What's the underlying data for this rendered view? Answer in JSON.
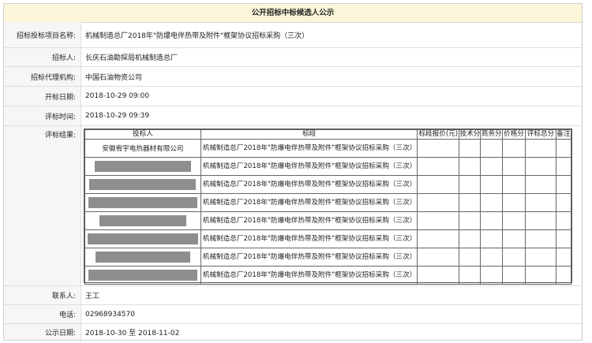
{
  "title": "公开招标中标候选人公示",
  "fields": {
    "project_label": "招标投标项目名称:",
    "project_value": "机械制造总厂2018年\"防爆电伴热带及附件\"框架协议招标采购（三次）",
    "tenderer_label": "招标人:",
    "tenderer_value": "长庆石油勘探局机械制造总厂",
    "agency_label": "招标代理机构:",
    "agency_value": "中国石油物资公司",
    "open_label": "开标日期:",
    "open_value": "2018-10-29 09:00",
    "eval_label": "评标时间:",
    "eval_value": "2018-10-29 09:39",
    "result_label": "评标结果:",
    "contact_label": "联系人:",
    "contact_value": "王工",
    "phone_label": "电话:",
    "phone_value": "02968934570",
    "pub_label": "公示日期:",
    "pub_value": "2018-10-30 至 2018-11-02"
  },
  "results": {
    "headers": [
      "投标人",
      "标段",
      "标段报价(元)",
      "技术分",
      "商务分",
      "价格分",
      "评标总分",
      "备注"
    ],
    "rows": [
      {
        "bidder": "安徽宥宇电热器材有限公司",
        "segment": "机械制造总厂2018年\"防爆电伴热带及附件\"框架协议招标采购（三次）"
      },
      {
        "bidder": "",
        "segment": "机械制造总厂2018年\"防爆电伴热带及附件\"框架协议招标采购（三次）"
      },
      {
        "bidder": "",
        "segment": "机械制造总厂2018年\"防爆电伴热带及附件\"框架协议招标采购（三次）"
      },
      {
        "bidder": "",
        "segment": "机械制造总厂2018年\"防爆电伴热带及附件\"框架协议招标采购（三次）"
      },
      {
        "bidder": "",
        "segment": "机械制造总厂2018年\"防爆电伴热带及附件\"框架协议招标采购（三次）"
      },
      {
        "bidder": "",
        "segment": "机械制造总厂2018年\"防爆电伴热带及附件\"框架协议招标采购（三次）"
      },
      {
        "bidder": "",
        "segment": "机械制造总厂2018年\"防爆电伴热带及附件\"框架协议招标采购（三次）"
      },
      {
        "bidder": "",
        "segment": "机械制造总厂2018年\"防爆电伴热带及附件\"框架协议招标采购（三次）"
      }
    ]
  }
}
